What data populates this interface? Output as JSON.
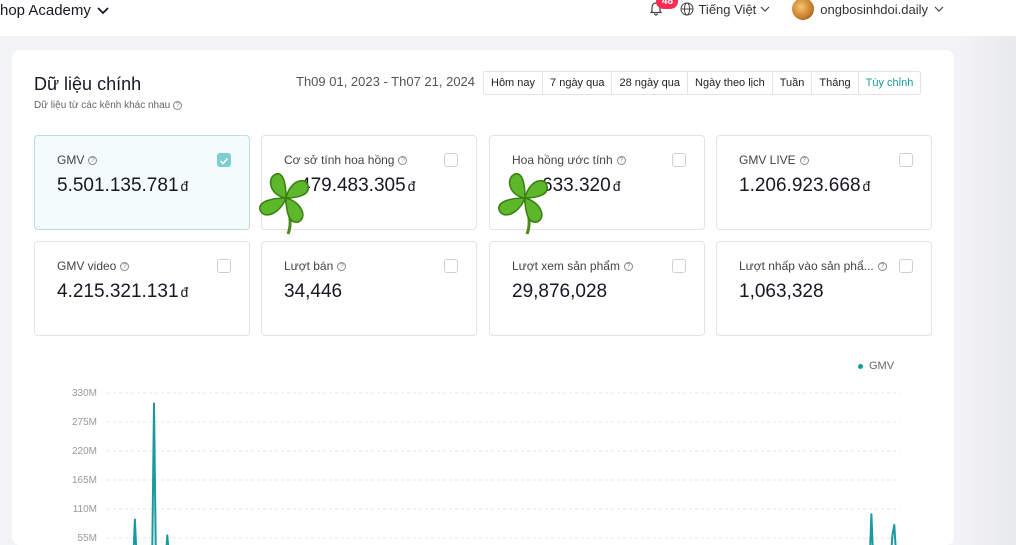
{
  "header": {
    "app_title": "hop Academy",
    "notification_count": "48",
    "language": "Tiếng Việt",
    "username": "ongbosinhdoi.daily"
  },
  "overview": {
    "title": "Dữ liệu chính",
    "subtitle": "Dữ liệu từ các kênh khác nhau",
    "date_range": "Th09 01, 2023 - Th07 21, 2024",
    "ranges": [
      "Hôm nay",
      "7 ngày qua",
      "28 ngày qua",
      "Ngày theo lịch",
      "Tuần",
      "Tháng",
      "Tùy chỉnh"
    ],
    "active_range": "Tùy chỉnh"
  },
  "metrics": [
    {
      "label": "GMV",
      "value": "5.501.135.781",
      "unit": "đ",
      "checked": true
    },
    {
      "label": "Cơ sở tính hoa hồng",
      "value": "479.483.305",
      "unit": "đ",
      "checked": false
    },
    {
      "label": "Hoa hồng ước tính",
      "value": "633.320",
      "unit": "đ",
      "checked": false
    },
    {
      "label": "GMV LIVE",
      "value": "1.206.923.668",
      "unit": "đ",
      "checked": false
    },
    {
      "label": "GMV video",
      "value": "4.215.321.131",
      "unit": "đ",
      "checked": false
    },
    {
      "label": "Lượt bán",
      "value": "34,446",
      "unit": "",
      "checked": false
    },
    {
      "label": "Lượt xem sản phẩm",
      "value": "29,876,028",
      "unit": "",
      "checked": false
    },
    {
      "label": "Lượt nhấp vào sản phẩ...",
      "value": "1,063,328",
      "unit": "",
      "checked": false
    }
  ],
  "overlays": {
    "sticker_icon": "four-leaf-clover-icon"
  },
  "colors": {
    "accent": "#1a9a9e",
    "badge": "#fe2c55",
    "selected_check": "#7ecdd1"
  },
  "chart_data": {
    "type": "line",
    "title": "",
    "xlabel": "",
    "ylabel": "",
    "ylim": [
      0,
      330
    ],
    "y_ticks": [
      "330M",
      "275M",
      "220M",
      "165M",
      "110M",
      "55M"
    ],
    "grid": true,
    "legend_position": "top-right",
    "series": [
      {
        "name": "GMV",
        "color": "#1a9a9e",
        "values": [
          2,
          2,
          2,
          2,
          4,
          3,
          2,
          2,
          2,
          2,
          4,
          5,
          90,
          8,
          3,
          2,
          35,
          4,
          3,
          2,
          2,
          3,
          310,
          10,
          4,
          3,
          2,
          20,
          6,
          60,
          15,
          4,
          3,
          2,
          2,
          2,
          2,
          2,
          2,
          2,
          2,
          2,
          2,
          2,
          2,
          2,
          2,
          2,
          2,
          2,
          2,
          2,
          2,
          2,
          2,
          2,
          2,
          2,
          2,
          2,
          2,
          2,
          2,
          2,
          2,
          2,
          2,
          2,
          2,
          2,
          2,
          2,
          2,
          2,
          2,
          2,
          2,
          2,
          2,
          2,
          2,
          2,
          2,
          2,
          2,
          2,
          2,
          2,
          2,
          2,
          2,
          2,
          2,
          2,
          2,
          2,
          2,
          2,
          2,
          2,
          2,
          2,
          2,
          2,
          2,
          2,
          2,
          2,
          2,
          2,
          2,
          2,
          2,
          2,
          2,
          2,
          2,
          2,
          2,
          2,
          2,
          2,
          2,
          2,
          2,
          2,
          2,
          2,
          2,
          2,
          2,
          2,
          2,
          2,
          2,
          2,
          2,
          2,
          2,
          2,
          2,
          2,
          2,
          2,
          2,
          2,
          2,
          2,
          2,
          2,
          2,
          2,
          2,
          2,
          2,
          2,
          2,
          2,
          2,
          2,
          2,
          2,
          2,
          2,
          2,
          2,
          2,
          2,
          2,
          2,
          2,
          2,
          2,
          2,
          2,
          2,
          2,
          2,
          2,
          2,
          2,
          2,
          2,
          2,
          2,
          2,
          2,
          2,
          2,
          2,
          2,
          2,
          2,
          2,
          2,
          2,
          2,
          2,
          2,
          2,
          2,
          2,
          2,
          2,
          2,
          2,
          2,
          2,
          2,
          2,
          2,
          2,
          2,
          2,
          2,
          2,
          2,
          2,
          2,
          2,
          2,
          2,
          2,
          2,
          2,
          2,
          2,
          2,
          2,
          2,
          2,
          2,
          2,
          2,
          2,
          2,
          2,
          2,
          2,
          2,
          2,
          2,
          2,
          2,
          2,
          2,
          2,
          2,
          2,
          2,
          2,
          2,
          2,
          2,
          2,
          2,
          2,
          2,
          2,
          2,
          2,
          2,
          2,
          2,
          2,
          2,
          2,
          2,
          2,
          2,
          2,
          2,
          2,
          2,
          2,
          2,
          2,
          2,
          2,
          2,
          2,
          2,
          2,
          2,
          2,
          2,
          2,
          2,
          2,
          2,
          2,
          2,
          2,
          2,
          2,
          2,
          2,
          2,
          2,
          2,
          2,
          2,
          2,
          2,
          2,
          2,
          2,
          2,
          2,
          2,
          2,
          2,
          4,
          2,
          2,
          2,
          2,
          2,
          2,
          6,
          2,
          2,
          2,
          8,
          3,
          2,
          2,
          2,
          2,
          2,
          2,
          2,
          2,
          2,
          2,
          2,
          2,
          2,
          2,
          2,
          2,
          2,
          2,
          2,
          2,
          2,
          2,
          2,
          3,
          5,
          2,
          2,
          3,
          8,
          3,
          2,
          2,
          2,
          2,
          3,
          5,
          2,
          2,
          2,
          3,
          2,
          2,
          2,
          4,
          3,
          2,
          2,
          2,
          2,
          2,
          2,
          2,
          2,
          2,
          2,
          2,
          2,
          2,
          3,
          4,
          2,
          2,
          2,
          2,
          2,
          2,
          8,
          4,
          2,
          2,
          2,
          2,
          3,
          100,
          10,
          3,
          2,
          2,
          2,
          2,
          3,
          2,
          2,
          6,
          60,
          80,
          20,
          3,
          2
        ]
      }
    ]
  }
}
